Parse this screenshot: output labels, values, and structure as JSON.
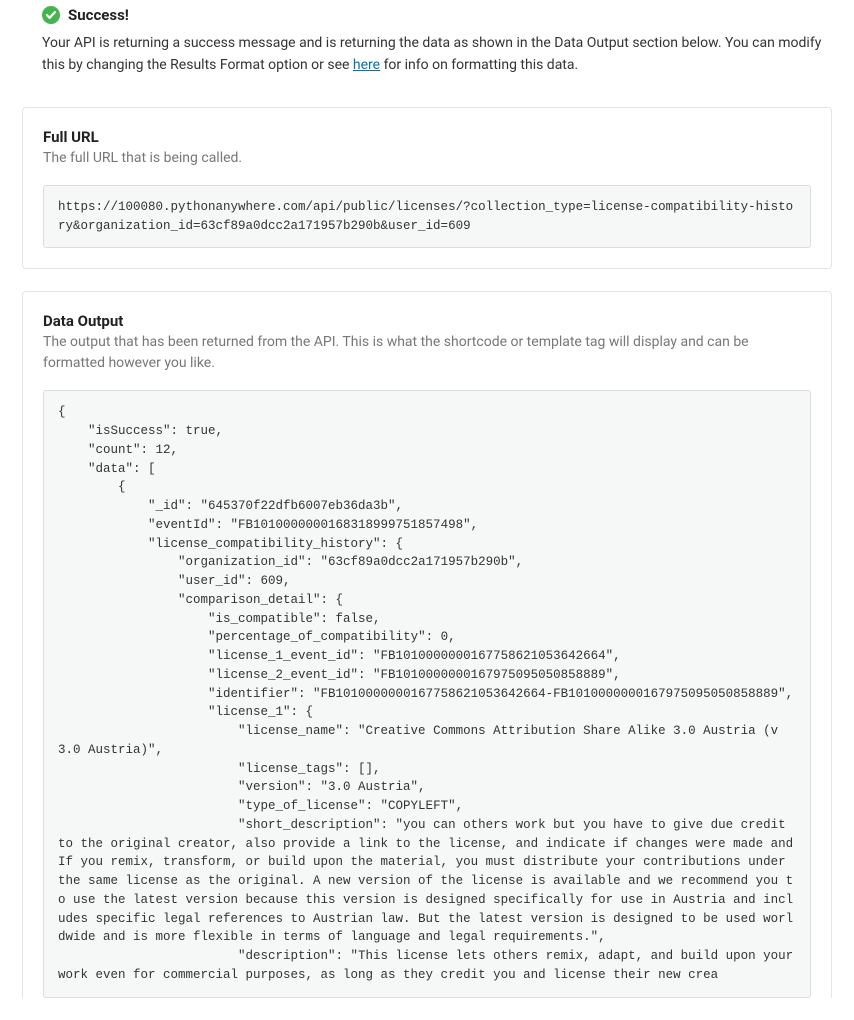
{
  "success": {
    "title": "Success!",
    "message_before": "Your API is returning a success message and is returning the data as shown in the Data Output section below. You can modify this by changing the Results Format option or see ",
    "link_text": "here",
    "message_after": " for info on formatting this data."
  },
  "full_url": {
    "title": "Full URL",
    "description": "The full URL that is being called.",
    "value": "https://100080.pythonanywhere.com/api/public/licenses/?collection_type=license-compatibility-history&organization_id=63cf89a0dcc2a171957b290b&user_id=609"
  },
  "data_output": {
    "title": "Data Output",
    "description": "The output that has been returned from the API. This is what the shortcode or template tag will display and can be formatted however you like.",
    "json": "{\n    \"isSuccess\": true,\n    \"count\": 12,\n    \"data\": [\n        {\n            \"_id\": \"645370f22dfb6007eb36da3b\",\n            \"eventId\": \"FB1010000000168318999751857498\",\n            \"license_compatibility_history\": {\n                \"organization_id\": \"63cf89a0dcc2a171957b290b\",\n                \"user_id\": 609,\n                \"comparison_detail\": {\n                    \"is_compatible\": false,\n                    \"percentage_of_compatibility\": 0,\n                    \"license_1_event_id\": \"FB1010000000167758621053642664\",\n                    \"license_2_event_id\": \"FB1010000000167975095050858889\",\n                    \"identifier\": \"FB1010000000167758621053642664-FB1010000000167975095050858889\",\n                    \"license_1\": {\n                        \"license_name\": \"Creative Commons Attribution Share Alike 3.0 Austria (v 3.0 Austria)\",\n                        \"license_tags\": [],\n                        \"version\": \"3.0 Austria\",\n                        \"type_of_license\": \"COPYLEFT\",\n                        \"short_description\": \"you can others work but you have to give due credit to the original creator, also provide a link to the license, and indicate if changes were made and If you remix, transform, or build upon the material, you must distribute your contributions under the same license as the original. A new version of the license is available and we recommend you to use the latest version because this version is designed specifically for use in Austria and includes specific legal references to Austrian law. But the latest version is designed to be used worldwide and is more flexible in terms of language and legal requirements.\",\n                        \"description\": \"This license lets others remix, adapt, and build upon your work even for commercial purposes, as long as they credit you and license their new crea"
  }
}
